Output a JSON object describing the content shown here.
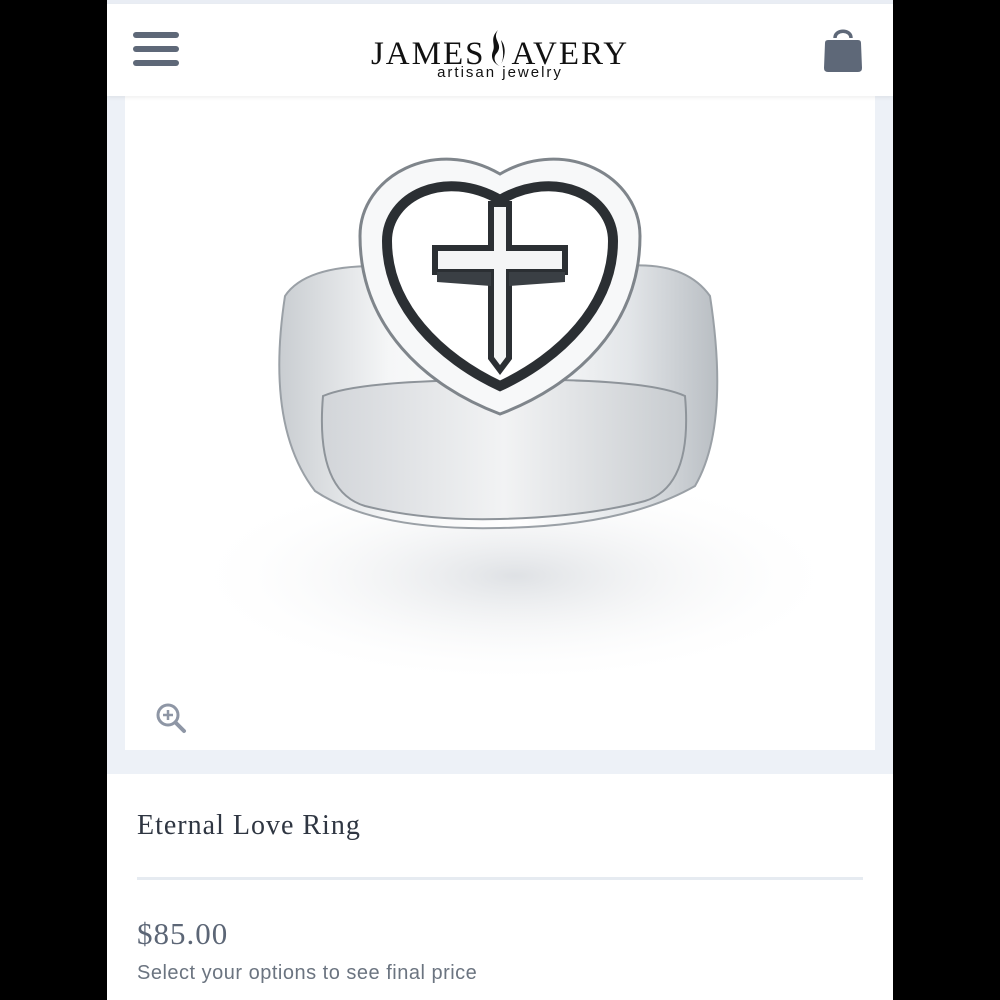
{
  "header": {
    "brand_name_left": "JAMES",
    "brand_name_right": "AVERY",
    "brand_tagline": "artisan jewelry",
    "menu_icon": "hamburger-menu-icon",
    "cart_icon": "shopping-bag-icon"
  },
  "product": {
    "image_subject": "sterling silver heart signet ring with cross",
    "zoom_icon": "zoom-in-icon",
    "title": "Eternal Love Ring",
    "price": "$85.00",
    "price_note": "Select your options to see final price"
  },
  "colors": {
    "icon_gray": "#5e6878",
    "title_text": "#2f3642",
    "price_text": "#5c6676",
    "panel_background": "#edf1f7"
  }
}
